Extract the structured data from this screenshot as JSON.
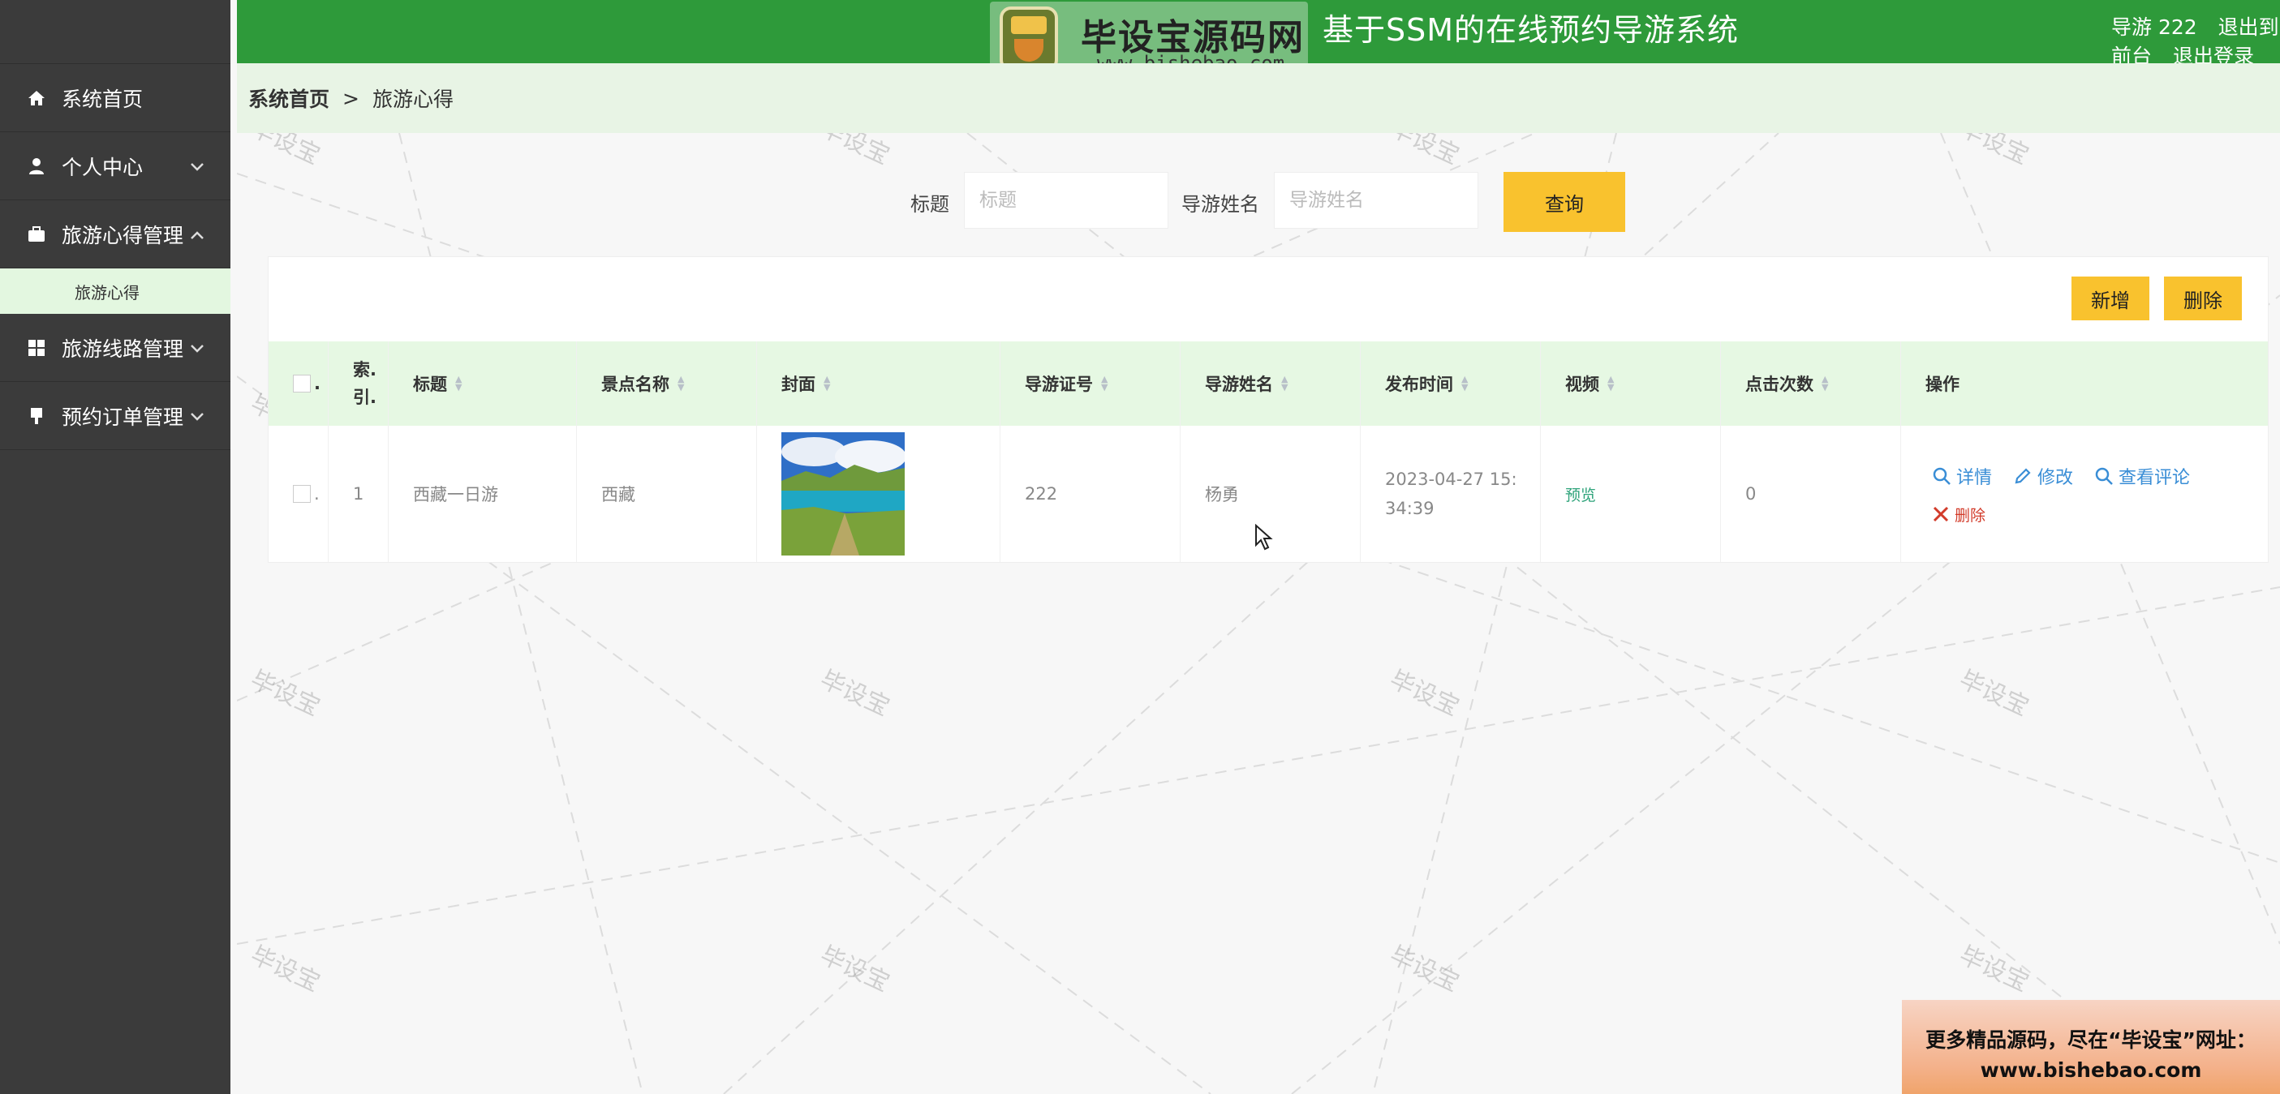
{
  "app": {
    "title": "基于SSM的在线预约导游系统"
  },
  "header": {
    "user_label": "导游 222",
    "to_front_label": "退出到前台",
    "logout_label": "退出登录"
  },
  "logo": {
    "badge_text": "毕设宝",
    "name": "毕设宝源码网",
    "url": "www.bishebao.com"
  },
  "sidebar": {
    "items": [
      {
        "label": "系统首页",
        "icon": "home-icon"
      },
      {
        "label": "个人中心",
        "icon": "user-icon",
        "chevron": "down"
      },
      {
        "label": "旅游心得管理",
        "icon": "briefcase-icon",
        "chevron": "up"
      },
      {
        "label": "旅游线路管理",
        "icon": "grid-icon",
        "chevron": "down"
      },
      {
        "label": "预约订单管理",
        "icon": "pin-icon",
        "chevron": "down"
      }
    ],
    "sub_items": [
      {
        "label": "旅游心得"
      }
    ]
  },
  "breadcrumb": {
    "home": "系统首页",
    "separator": ">",
    "current": "旅游心得"
  },
  "search": {
    "title_label": "标题",
    "title_placeholder": "标题",
    "guide_label": "导游姓名",
    "guide_placeholder": "导游姓名",
    "query_label": "查询"
  },
  "toolbar": {
    "add_label": "新增",
    "delete_label": "删除"
  },
  "table": {
    "select_all_label": ".",
    "headers": [
      "索.\n引.",
      "标题",
      "景点名称",
      "封面",
      "导游证号",
      "导游姓名",
      "发布时间",
      "视频",
      "点击次数",
      "操作"
    ],
    "rows": [
      {
        "checkbox_label": ".",
        "index": "1",
        "title": "西藏一日游",
        "spot": "西藏",
        "guide_id": "222",
        "guide_name": "杨勇",
        "publish_time": "2023-04-27 15:34:39",
        "video": "预览",
        "clicks": "0",
        "actions": {
          "detail": "详情",
          "edit": "修改",
          "comments": "查看评论",
          "delete": "删除"
        }
      }
    ]
  },
  "watermark": "毕设宝",
  "promo": {
    "line1": "更多精品源码，尽在“毕设宝”网址：",
    "line2": "www.bishebao.com"
  },
  "colors": {
    "header_green": "#2e9a3a",
    "sidebar_dark": "#3b3b3b",
    "accent_yellow": "#f9c22e",
    "table_header_green": "#e6f8e3",
    "link_blue": "#3a8ed6",
    "delete_red": "#d23b2a"
  }
}
